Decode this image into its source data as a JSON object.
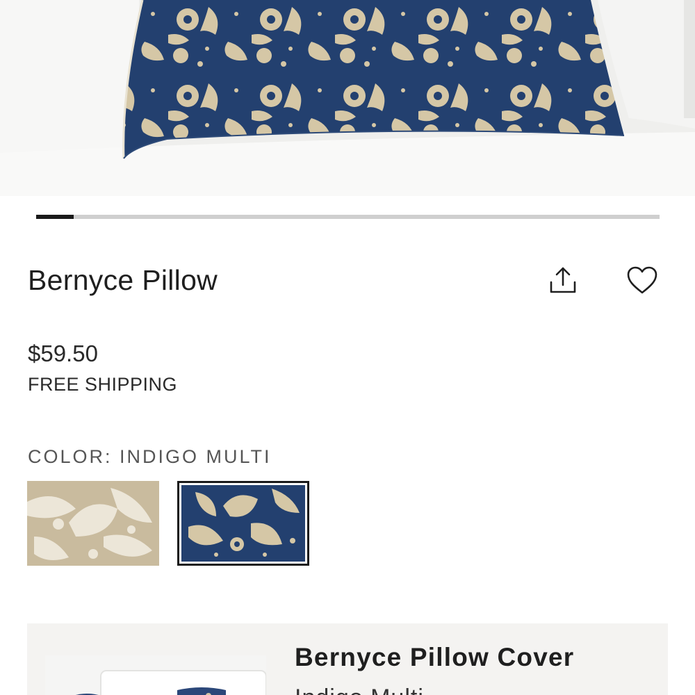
{
  "hero": {
    "image": "bernyce-pillow-on-white-sofa",
    "carousel_progress": 0.06
  },
  "product": {
    "title": "Bernyce Pillow",
    "price": "$59.50",
    "shipping": "FREE SHIPPING"
  },
  "actions": {
    "share_icon": "share-icon",
    "favorite_icon": "heart-icon"
  },
  "color": {
    "label": "COLOR: INDIGO MULTI",
    "selected": "Indigo Multi",
    "swatches": [
      {
        "pattern": "natural-linen-floral",
        "selected": false
      },
      {
        "pattern": "indigo-floral",
        "selected": true
      }
    ]
  },
  "related": {
    "title": "Bernyce Pillow Cover",
    "subtitle": "Indigo Multi"
  },
  "colors": {
    "indigo": "#243f6e",
    "linen": "#d9ceb5",
    "text": "#222222",
    "card_bg": "#f4f3f1"
  }
}
